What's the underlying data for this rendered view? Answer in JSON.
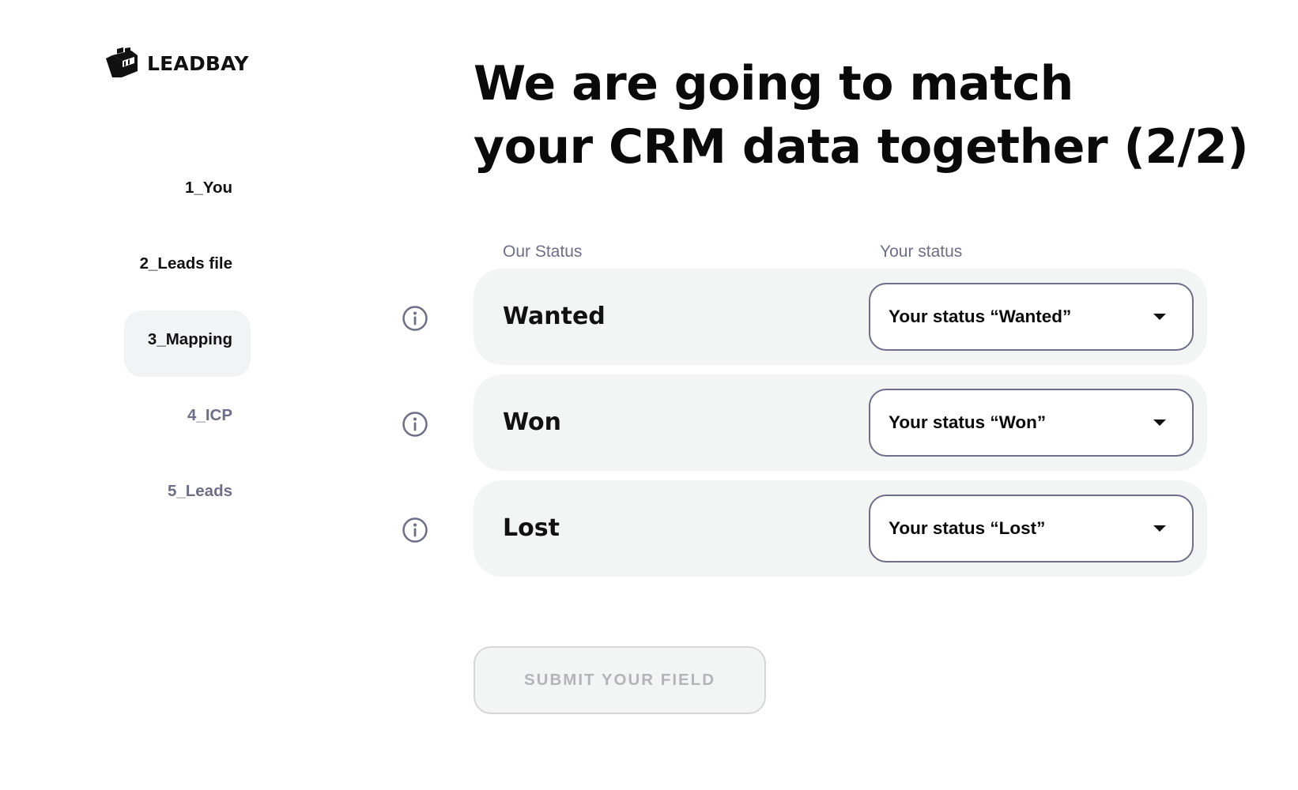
{
  "brand": {
    "name": "LEADBAY",
    "logo_icon": "leadbay-logo-icon"
  },
  "steps": [
    {
      "label": "1_You",
      "state": "done"
    },
    {
      "label": "2_Leads file",
      "state": "done"
    },
    {
      "label": "3_Mapping",
      "state": "active"
    },
    {
      "label": "4_ICP",
      "state": "upcoming"
    },
    {
      "label": "5_Leads",
      "state": "upcoming"
    }
  ],
  "title": {
    "line1": "We are going to match",
    "line2": "your CRM data together (2/2)"
  },
  "columns": {
    "our": "Our Status",
    "yours": "Your status"
  },
  "rows": [
    {
      "status": "Wanted",
      "selected": "Your status “Wanted”",
      "icon": "info-icon"
    },
    {
      "status": "Won",
      "selected": "Your status “Won”",
      "icon": "info-icon"
    },
    {
      "status": "Lost",
      "selected": "Your status “Lost”",
      "icon": "info-icon"
    }
  ],
  "submit": {
    "label": "SUBMIT YOUR FIELD",
    "disabled": true
  },
  "colors": {
    "muted": "#6d6e87",
    "row_bg": "#f3f4f4",
    "text": "#0a0a0a"
  }
}
